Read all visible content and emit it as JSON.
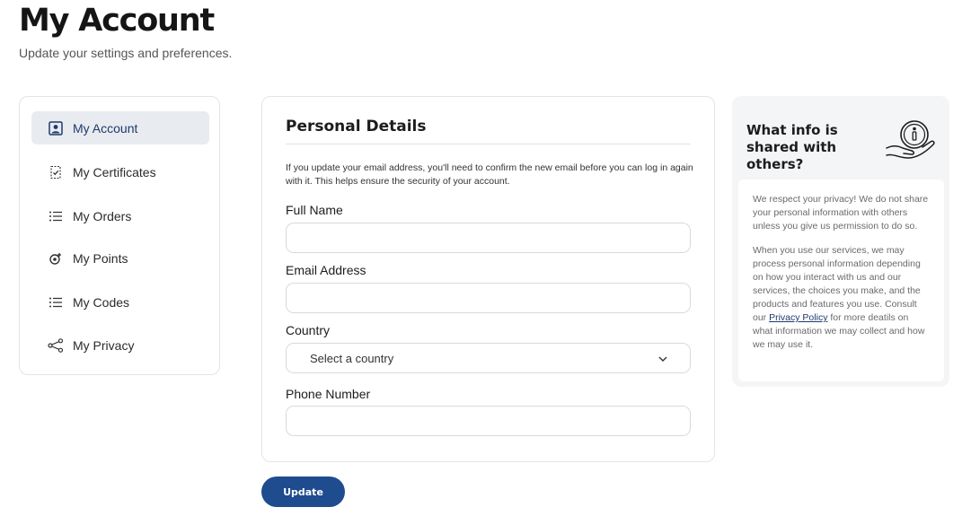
{
  "header": {
    "title": "My Account",
    "subtitle": "Update your settings and preferences."
  },
  "sidebar": {
    "items": [
      {
        "label": "My Account",
        "icon": "user-square-icon",
        "active": true
      },
      {
        "label": "My Certificates",
        "icon": "certificate-icon",
        "active": false
      },
      {
        "label": "My Orders",
        "icon": "list-icon",
        "active": false
      },
      {
        "label": "My Points",
        "icon": "points-icon",
        "active": false
      },
      {
        "label": "My Codes",
        "icon": "list-icon",
        "active": false
      },
      {
        "label": "My Privacy",
        "icon": "share-icon",
        "active": false
      }
    ]
  },
  "form": {
    "title": "Personal Details",
    "note": "If you update your email address, you'll need to confirm the new email before you can log in again with it. This helps ensure the security of your account.",
    "full_name_label": "Full Name",
    "full_name_value": "",
    "email_label": "Email Address",
    "email_value": "",
    "country_label": "Country",
    "country_selected": "Select a country",
    "phone_label": "Phone Number",
    "phone_value": "",
    "update_label": "Update"
  },
  "info": {
    "title": "What info is shared with others?",
    "paragraph1": "We respect your privacy! We do not share your personal information with others unless you give us permission to do so.",
    "paragraph2_before": "When you use our services, we may process personal information depending on how you interact with us and our services, the choices you make, and the products and features you use. Consult our ",
    "link_text": "Privacy Policy",
    "paragraph2_after": " for more deatils on what information we may collect and how we may use it."
  },
  "colors": {
    "primary": "#1f4b8f",
    "active_bg": "#e8ebef",
    "panel_bg": "#f4f5f7"
  }
}
